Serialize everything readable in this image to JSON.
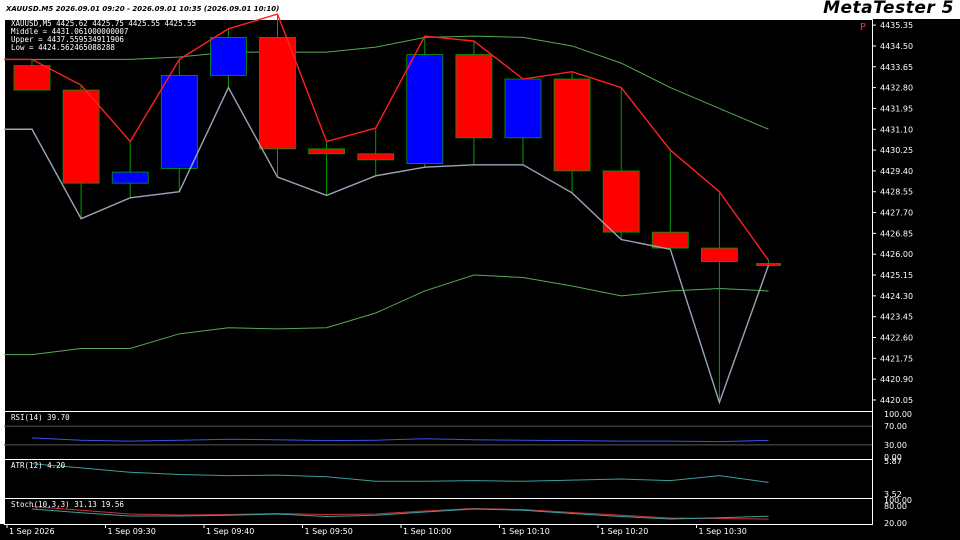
{
  "header": {
    "info": "XAUUSD.M5   2026.09.01 09:20 - 2026.09.01 10:35  (2026.09.01 10:10)",
    "brand": "MetaTester 5",
    "corner_mark": "P"
  },
  "overlay": {
    "ohlc": "XAUUSD,M5  4425.62 4425.75 4425.55 4425.55",
    "middle": "Middle = 4431.061000000007",
    "upper": "Upper = 4437.559534911906",
    "low": "Low = 4424.562465088288"
  },
  "price_axis": [
    "4435.35",
    "4434.50",
    "4433.65",
    "4432.80",
    "4431.95",
    "4431.10",
    "4430.25",
    "4429.40",
    "4428.55",
    "4427.70",
    "4426.85",
    "4426.00",
    "4425.15",
    "4424.30",
    "4423.45",
    "4422.60",
    "4421.75",
    "4420.90",
    "4420.05"
  ],
  "time_axis": [
    "1 Sep 2026",
    "1 Sep 09:30",
    "1 Sep 09:40",
    "1 Sep 09:50",
    "1 Sep 10:00",
    "1 Sep 10:10",
    "1 Sep 10:20",
    "1 Sep 10:30"
  ],
  "indicators": {
    "rsi": {
      "label": "RSI(14) 39.70",
      "levels": [
        "100.00",
        "70.00",
        "30.00",
        "0.00"
      ]
    },
    "atr": {
      "label": "ATR(12) 4.20",
      "levels": [
        "5.87",
        "3.52"
      ]
    },
    "stoch": {
      "label": "Stoch(10,3,3) 31.13 19.56",
      "levels": [
        "100.00",
        "80.00",
        "20.00"
      ]
    }
  },
  "colors": {
    "background": "#000000",
    "bull": "#0000ff",
    "bear": "#ff0000",
    "wick": "#00a000",
    "grid": "#ffffff",
    "bands": "#55aa55",
    "high_line": "#ff2020",
    "low_line": "#9aa3b8",
    "rsi": "#3355ee",
    "atr": "#3aa0a0",
    "stoch_main": "#3aa0a0",
    "stoch_signal": "#d03030"
  },
  "chart_data": {
    "type": "candlestick",
    "symbol": "XAUUSD",
    "timeframe": "M5",
    "candles": [
      {
        "t": "09:20",
        "o": 4433.7,
        "h": 4433.95,
        "l": 4432.9,
        "c": 4432.7,
        "dir": "bear"
      },
      {
        "t": "09:25",
        "o": 4432.7,
        "h": 4432.9,
        "l": 4427.45,
        "c": 4428.9,
        "dir": "bear"
      },
      {
        "t": "09:30",
        "o": 4428.9,
        "h": 4430.6,
        "l": 4428.3,
        "c": 4429.35,
        "dir": "bull"
      },
      {
        "t": "09:35",
        "o": 4429.5,
        "h": 4433.95,
        "l": 4428.55,
        "c": 4433.3,
        "dir": "bull"
      },
      {
        "t": "09:40",
        "o": 4433.3,
        "h": 4435.2,
        "l": 4432.8,
        "c": 4434.85,
        "dir": "bull"
      },
      {
        "t": "09:45",
        "o": 4434.85,
        "h": 4435.8,
        "l": 4429.15,
        "c": 4430.3,
        "dir": "bear"
      },
      {
        "t": "09:50",
        "o": 4430.3,
        "h": 4430.6,
        "l": 4428.4,
        "c": 4430.1,
        "dir": "bear"
      },
      {
        "t": "09:55",
        "o": 4430.1,
        "h": 4431.15,
        "l": 4429.2,
        "c": 4429.85,
        "dir": "bear"
      },
      {
        "t": "10:00",
        "o": 4429.7,
        "h": 4434.9,
        "l": 4429.55,
        "c": 4434.15,
        "dir": "bull"
      },
      {
        "t": "10:05",
        "o": 4434.15,
        "h": 4434.7,
        "l": 4429.65,
        "c": 4430.75,
        "dir": "bear"
      },
      {
        "t": "10:10",
        "o": 4430.75,
        "h": 4433.15,
        "l": 4429.65,
        "c": 4433.15,
        "dir": "bull"
      },
      {
        "t": "10:15",
        "o": 4433.15,
        "h": 4433.45,
        "l": 4428.5,
        "c": 4429.4,
        "dir": "bear"
      },
      {
        "t": "10:20",
        "o": 4429.4,
        "h": 4432.8,
        "l": 4426.6,
        "c": 4426.9,
        "dir": "bear"
      },
      {
        "t": "10:25",
        "o": 4426.9,
        "h": 4430.25,
        "l": 4426.2,
        "c": 4426.25,
        "dir": "bear"
      },
      {
        "t": "10:30",
        "o": 4426.25,
        "h": 4428.55,
        "l": 4419.95,
        "c": 4425.7,
        "dir": "bear"
      },
      {
        "t": "10:35",
        "o": 4425.62,
        "h": 4425.75,
        "l": 4425.55,
        "c": 4425.55,
        "dir": "bear"
      }
    ],
    "upper_band": [
      4433.95,
      4433.95,
      4433.95,
      4434.05,
      4434.25,
      4434.25,
      4434.25,
      4434.45,
      4434.85,
      4434.9,
      4434.85,
      4434.5,
      4433.8,
      4432.8,
      4431.95,
      4431.1
    ],
    "lower_band": [
      4421.9,
      4422.15,
      4422.15,
      4422.75,
      4423.0,
      4422.95,
      4423.0,
      4423.6,
      4424.5,
      4425.15,
      4425.05,
      4424.7,
      4424.3,
      4424.5,
      4424.6,
      4424.5
    ],
    "high_line": [
      4433.95,
      4432.9,
      4430.6,
      4433.95,
      4435.2,
      4435.8,
      4430.6,
      4431.15,
      4434.9,
      4434.7,
      4433.15,
      4433.45,
      4432.8,
      4430.25,
      4428.55,
      4425.75
    ],
    "low_line": [
      4431.1,
      4427.45,
      4428.3,
      4428.55,
      4432.8,
      4429.15,
      4428.4,
      4429.2,
      4429.55,
      4429.65,
      4429.65,
      4428.5,
      4426.6,
      4426.2,
      4419.95,
      4425.55
    ],
    "rsi": [
      45,
      40,
      38,
      40,
      42,
      41,
      39,
      40,
      43,
      41,
      40,
      39,
      38,
      38,
      37,
      39.7
    ],
    "atr": [
      5.87,
      5.5,
      5.1,
      4.9,
      4.8,
      4.85,
      4.7,
      4.3,
      4.3,
      4.35,
      4.3,
      4.4,
      4.5,
      4.35,
      4.8,
      4.2
    ],
    "stoch_main": [
      60,
      45,
      32,
      32,
      35,
      40,
      30,
      35,
      48,
      60,
      55,
      42,
      30,
      20,
      25,
      31.13
    ],
    "stoch_signal": [
      70,
      55,
      40,
      36,
      38,
      42,
      38,
      40,
      52,
      62,
      58,
      46,
      35,
      24,
      22,
      19.56
    ],
    "price_range": [
      4419.6,
      4435.6
    ]
  }
}
